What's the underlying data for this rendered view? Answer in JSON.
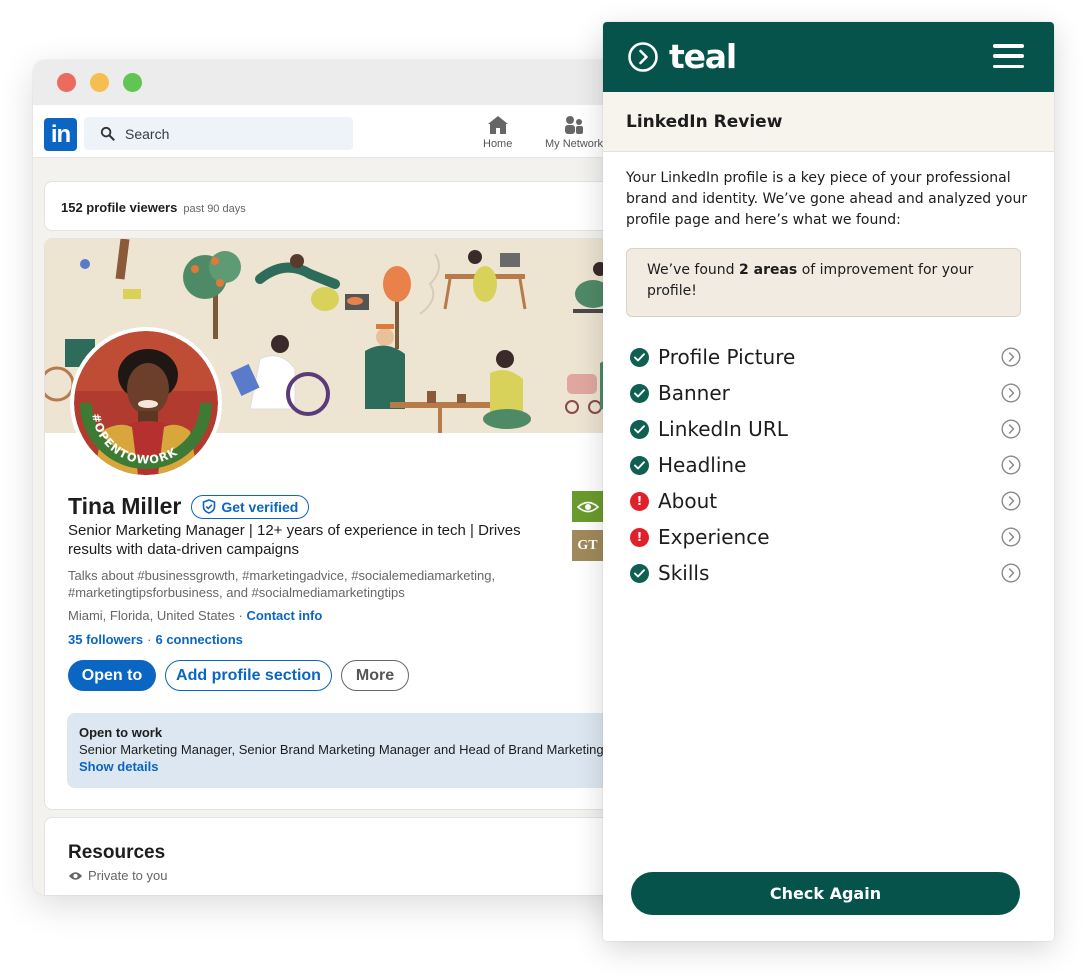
{
  "linkedin": {
    "search_placeholder": "Search",
    "nav": {
      "home": "Home",
      "network": "My Network"
    },
    "viewers": {
      "count_text": "152 profile viewers",
      "period": "past 90 days"
    },
    "profile": {
      "name": "Tina Miller",
      "verify_label": "Get verified",
      "open_to_work_badge": "#OPENTOWORK",
      "headline": "Senior Marketing Manager | 12+ years of experience in tech | Drives results with data-driven campaigns",
      "talks_about": "Talks about #businessgrowth, #marketingadvice, #socialemediamarketing, #marketingtipsforbusiness, and #socialmediamarketingtips",
      "location": "Miami, Florida, United States · ",
      "contact_info": "Contact info",
      "followers": "35 followers",
      "connections": "6 connections",
      "buttons": {
        "open_to": "Open to",
        "add_section": "Add profile section",
        "more": "More"
      },
      "open_to_work": {
        "title": "Open to work",
        "roles": "Senior Marketing Manager, Senior Brand Marketing Manager and Head of Brand Marketing",
        "show_details": "Show details"
      },
      "company_logo_text": "GT"
    },
    "resources": {
      "title": "Resources",
      "privacy": "Private to you"
    }
  },
  "teal": {
    "brand": "teal",
    "section_title": "LinkedIn Review",
    "intro": "Your LinkedIn profile is a key piece of your professional brand and identity. We’ve gone ahead and analyzed your profile page and here’s what we found:",
    "callout": {
      "prefix": "We’ve found ",
      "highlight": "2 areas",
      "suffix": " of improvement for your profile!"
    },
    "checks": [
      {
        "label": "Profile Picture",
        "status": "ok"
      },
      {
        "label": "Banner",
        "status": "ok"
      },
      {
        "label": "LinkedIn URL",
        "status": "ok"
      },
      {
        "label": "Headline",
        "status": "ok"
      },
      {
        "label": "About",
        "status": "issue"
      },
      {
        "label": "Experience",
        "status": "issue"
      },
      {
        "label": "Skills",
        "status": "ok"
      }
    ],
    "check_again_label": "Check Again",
    "colors": {
      "brand_green": "#05534a",
      "ok": "#0f5f52",
      "issue": "#e0202a",
      "linkedin_blue": "#0a66c2"
    }
  }
}
